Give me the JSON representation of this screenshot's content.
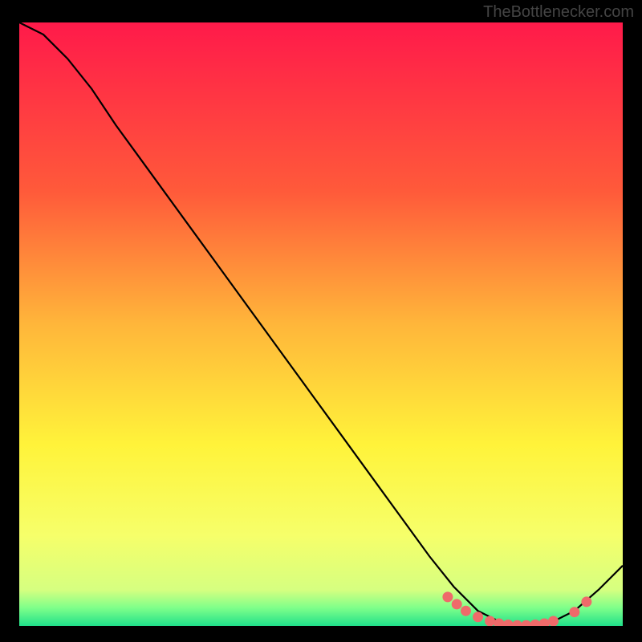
{
  "attribution": "TheBottlenecker.com",
  "chart_data": {
    "type": "line",
    "title": "",
    "xlabel": "",
    "ylabel": "",
    "xlim": [
      0,
      100
    ],
    "ylim": [
      0,
      100
    ],
    "series": [
      {
        "name": "curve",
        "x": [
          0,
          4,
          8,
          12,
          16,
          20,
          24,
          28,
          32,
          36,
          40,
          44,
          48,
          52,
          56,
          60,
          64,
          68,
          72,
          76,
          80,
          84,
          88,
          92,
          96,
          100
        ],
        "y": [
          100,
          98,
          94,
          89,
          83,
          77.5,
          72,
          66.5,
          61,
          55.5,
          50,
          44.5,
          39,
          33.5,
          28,
          22.5,
          17,
          11.5,
          6.5,
          2.5,
          0.5,
          0,
          0.5,
          2.5,
          6,
          10
        ]
      }
    ],
    "markers": {
      "x": [
        71,
        72.5,
        74,
        76,
        78,
        79.5,
        81,
        82.5,
        84,
        85.5,
        87,
        88.5,
        92,
        94
      ],
      "y": [
        4.8,
        3.6,
        2.5,
        1.5,
        0.8,
        0.4,
        0.2,
        0.1,
        0.1,
        0.2,
        0.4,
        0.8,
        2.3,
        4.0
      ]
    },
    "background_gradient": {
      "stops": [
        {
          "offset": 0,
          "color": "#ff1a4a"
        },
        {
          "offset": 28,
          "color": "#ff5a3a"
        },
        {
          "offset": 50,
          "color": "#ffb63a"
        },
        {
          "offset": 70,
          "color": "#fff33a"
        },
        {
          "offset": 85,
          "color": "#f6ff6a"
        },
        {
          "offset": 94,
          "color": "#d6ff80"
        },
        {
          "offset": 97,
          "color": "#7fff8a"
        },
        {
          "offset": 100,
          "color": "#20e08a"
        }
      ]
    }
  }
}
